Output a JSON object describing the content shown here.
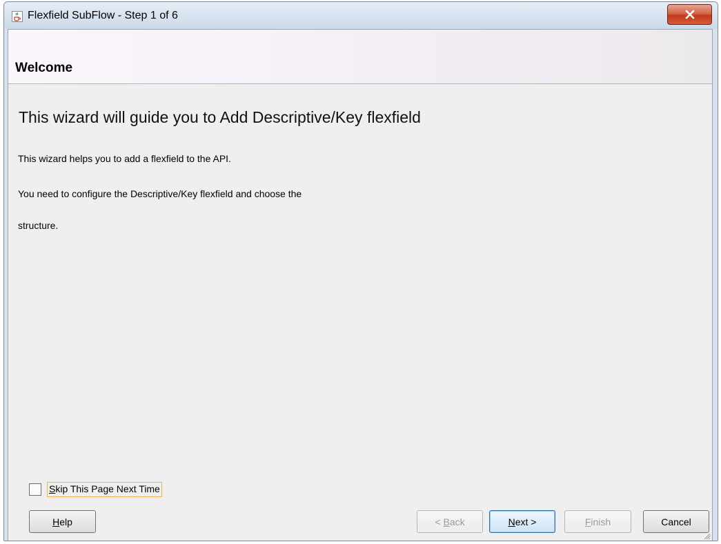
{
  "window": {
    "title": "Flexfield SubFlow - Step 1 of 6",
    "close_label": "X"
  },
  "header": {
    "title": "Welcome"
  },
  "content": {
    "heading": "This wizard will guide you to Add Descriptive/Key flexfield",
    "line1": "This wizard helps you to add a flexfield to the API.",
    "line2": "You need to configure the Descriptive/Key flexfield and choose the",
    "line3": "structure."
  },
  "skip": {
    "mnemonic": "S",
    "rest": "kip This Page Next Time",
    "checked": false
  },
  "buttons": {
    "help": {
      "mnemonic": "H",
      "rest": "elp"
    },
    "back": {
      "prefix": "< ",
      "mnemonic": "B",
      "rest": "ack"
    },
    "next": {
      "mnemonic": "N",
      "rest": "ext >"
    },
    "finish": {
      "mnemonic": "F",
      "rest": "inish"
    },
    "cancel": {
      "label": "Cancel"
    }
  },
  "icons": {
    "app": "java-coffee-cup-icon",
    "close": "close-icon"
  }
}
